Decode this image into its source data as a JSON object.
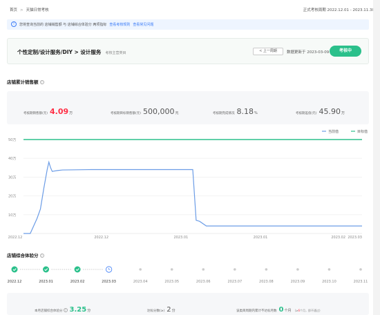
{
  "breadcrumb": {
    "home": "首页",
    "separator": ">",
    "current": "天猫日常考核"
  },
  "period": "正式考核周期 2022.12.01 - 2023.11.30",
  "notice": {
    "text": "您将查询当前的 店铺销售额 与 店铺综合体验分 两项指标",
    "link1": "查看考核规则",
    "link2": "查看常见问题"
  },
  "service": {
    "name": "个性定制/设计服务/DIY > 设计服务",
    "category_label": "考核主营类目",
    "prev_button": "< 上一周期",
    "update": "数据更新于 2023-03-09",
    "status": "考核中"
  },
  "sales": {
    "section_title": "店铺累计销售额",
    "actual_label": "考核期销售额(元)",
    "actual_value": "4.09",
    "actual_unit": "万",
    "target_label": "考核期目标销售额(元)",
    "target_value": "500,000",
    "target_unit": "元",
    "rate_label": "考核期完成情况",
    "rate_value": "8.18",
    "rate_unit": "%",
    "gap_label": "考核期差值(元)",
    "gap_value": "45.90",
    "gap_unit": "万"
  },
  "chart_data": {
    "type": "line",
    "x_ticks": [
      "2022.12",
      "2022.12",
      "2023.01",
      "2023.01",
      "2023.02",
      "2023.03"
    ],
    "y_ticks": [
      "10万",
      "20万",
      "30万",
      "40万",
      "50万"
    ],
    "ylim": [
      0,
      50
    ],
    "series": [
      {
        "name": "当前值",
        "color": "#6b9ce6",
        "x": [
          0,
          4,
          8,
          10,
          12,
          14,
          15,
          16,
          17,
          18,
          20,
          23,
          40,
          100,
          102,
          104,
          108,
          200
        ],
        "values": [
          0,
          0,
          8,
          13,
          24,
          34,
          38,
          35,
          33,
          33.2,
          33.5,
          33.8,
          34,
          34,
          7,
          6.5,
          4,
          4
        ]
      },
      {
        "name": "目标值",
        "color": "#2bc08b",
        "x": [
          0,
          200
        ],
        "values": [
          50,
          50
        ]
      }
    ],
    "grid": true,
    "legend": "top-right"
  },
  "colors": {
    "accent": "#2bc08b",
    "red": "#ff2f45",
    "blue": "#3b7cf7"
  },
  "experience": {
    "section_title": "店铺综合体验分",
    "months": [
      "2022.12",
      "2023.01",
      "2023.02",
      "2023.03",
      "2023.04",
      "2023.05",
      "2023.06",
      "2023.07",
      "2023.08",
      "2023.09",
      "2023.10",
      "2023.11"
    ],
    "score_label": "本月店铺综合体验分",
    "score_value": "3.25",
    "score_unit": "分",
    "pass_label": "达标分数(≥)",
    "pass_value": "2",
    "pass_unit": "分",
    "fail_label": "该类目周期内累计不达标月数",
    "fail_value": "0",
    "fail_unit": "个月",
    "fail_note_a": "(≥",
    "fail_note_b": "6",
    "fail_note_c": "个月，即不通过)"
  }
}
